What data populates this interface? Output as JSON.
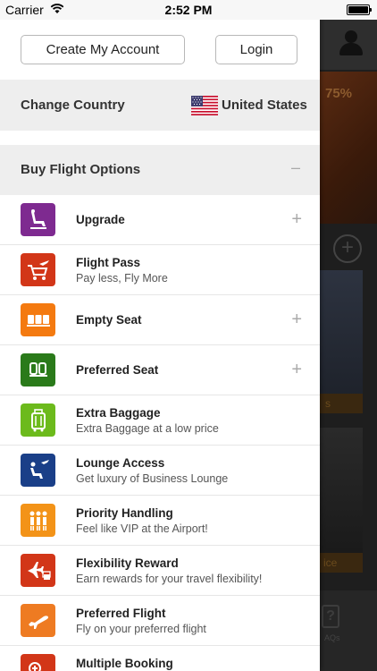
{
  "status_bar": {
    "carrier": "Carrier",
    "time": "2:52 PM"
  },
  "background": {
    "banner_text": "75%",
    "tile1_label": "s",
    "tile2_label": "ice",
    "faq_label": "AQs"
  },
  "account": {
    "create_label": "Create My Account",
    "login_label": "Login"
  },
  "country": {
    "label": "Change Country",
    "value": "United States"
  },
  "section": {
    "label": "Buy Flight Options",
    "toggle": "–"
  },
  "menu": [
    {
      "title": "Upgrade",
      "subtitle": "",
      "icon": "seat-recline-icon",
      "color": "#7e2a90",
      "expandable": true
    },
    {
      "title": "Flight Pass",
      "subtitle": "Pay less, Fly More",
      "icon": "cart-plane-icon",
      "color": "#d23618",
      "expandable": false
    },
    {
      "title": "Empty Seat",
      "subtitle": "",
      "icon": "seat-row-icon",
      "color": "#f47a10",
      "expandable": true
    },
    {
      "title": "Preferred Seat",
      "subtitle": "",
      "icon": "double-seat-icon",
      "color": "#2a7a1a",
      "expandable": true
    },
    {
      "title": "Extra Baggage",
      "subtitle": "Extra Baggage at a low price",
      "icon": "luggage-icon",
      "color": "#6cba1c",
      "expandable": false
    },
    {
      "title": "Lounge Access",
      "subtitle": "Get luxury of Business Lounge",
      "icon": "lounge-icon",
      "color": "#1a3f88",
      "expandable": false
    },
    {
      "title": "Priority Handling",
      "subtitle": "Feel like VIP at the Airport!",
      "icon": "people-icon",
      "color": "#f39318",
      "expandable": false
    },
    {
      "title": "Flexibility Reward",
      "subtitle": "Earn rewards for your travel flexibility!",
      "icon": "plane-money-icon",
      "color": "#d23618",
      "expandable": false
    },
    {
      "title": "Preferred Flight",
      "subtitle": "Fly on your preferred flight",
      "icon": "takeoff-icon",
      "color": "#ee7b22",
      "expandable": false
    },
    {
      "title": "Multiple Booking",
      "subtitle": "",
      "icon": "multi-booking-icon",
      "color": "#d23618",
      "expandable": false
    }
  ],
  "expand_glyph": "+"
}
